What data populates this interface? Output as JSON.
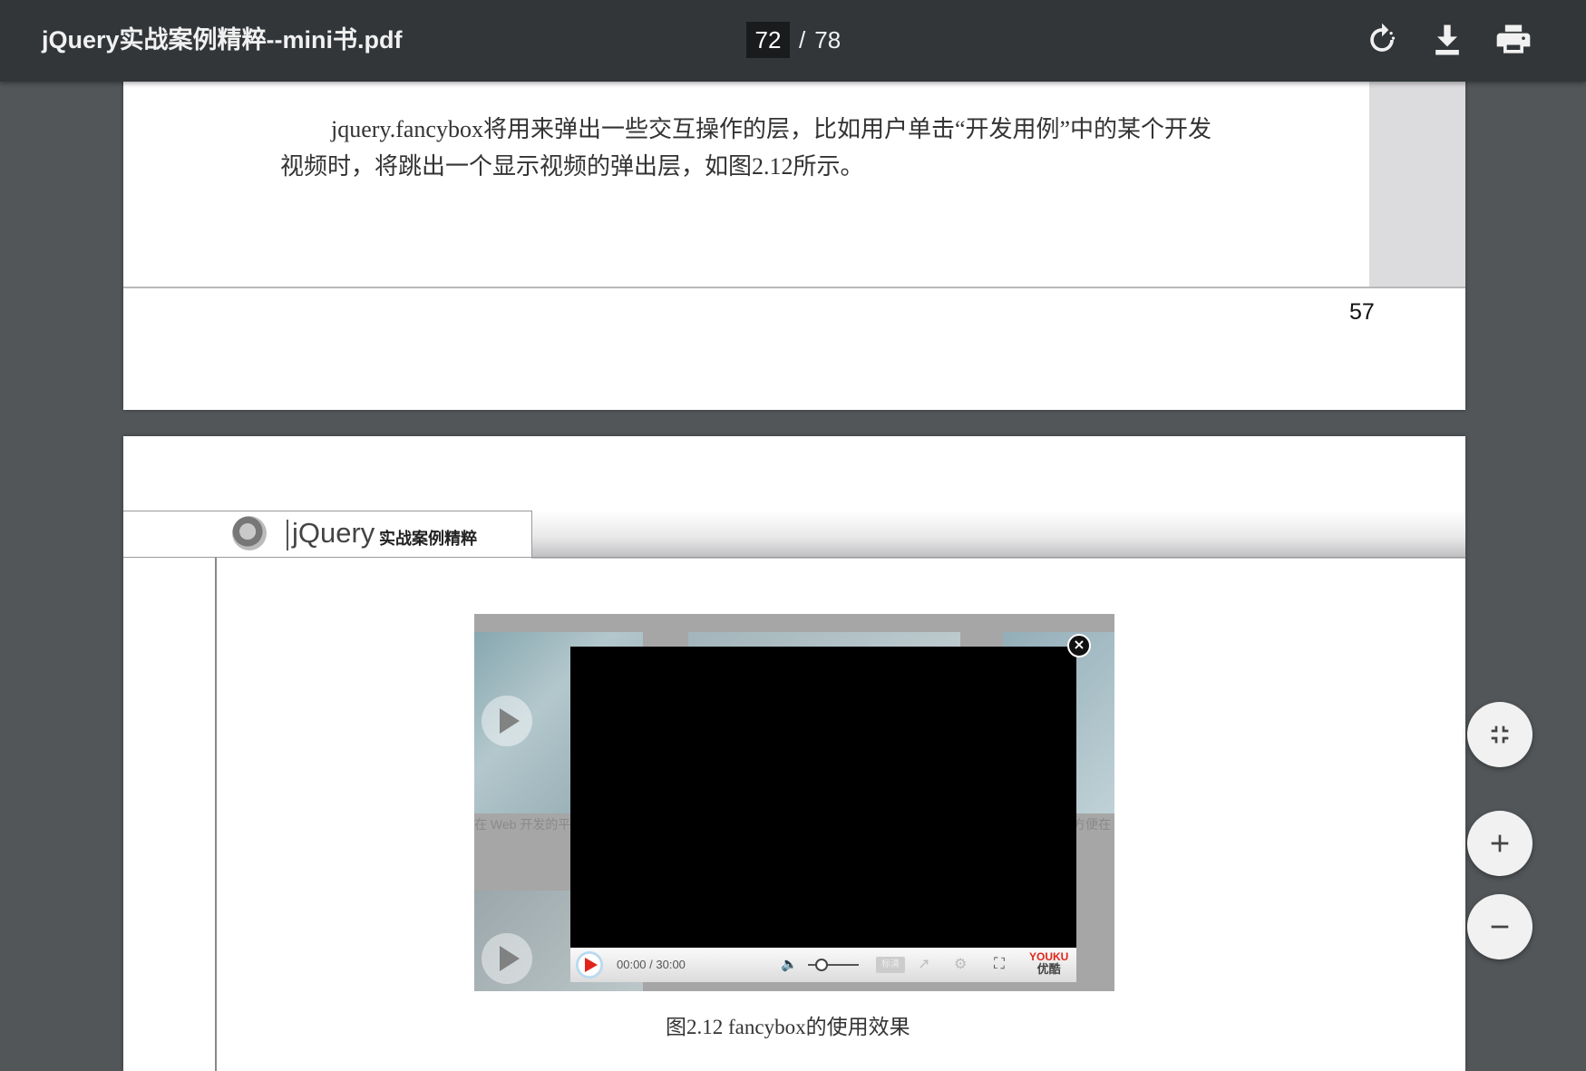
{
  "toolbar": {
    "title": "jQuery实战案例精粹--mini书.pdf",
    "current_page": "72",
    "separator": "/",
    "total_pages": "78",
    "buttons": [
      {
        "icon": "rotate-icon"
      },
      {
        "icon": "download-icon"
      },
      {
        "icon": "print-icon"
      }
    ]
  },
  "page1": {
    "paragraph_line1": "jquery.fancybox将用来弹出一些交互操作的层，比如用户单击“开发用例”中的某个开发",
    "paragraph_line2": "视频时，将跳出一个显示视频的弹出层，如图2.12所示。",
    "page_number": "57"
  },
  "page2": {
    "header_logo_text": "jQuery",
    "header_logo_cn": "实战案例精粹",
    "figure": {
      "faded_left": "在 Web 开发的平",
      "faded_right": "方便在",
      "player_time": "00:00 / 30:00",
      "quality_label": "标清",
      "brand_en": "YOUKU",
      "brand_cn": "优酷"
    },
    "caption": "图2.12  fancybox的使用效果"
  },
  "zoom_controls": [
    {
      "icon": "fit-page-icon"
    },
    {
      "icon": "zoom-in-icon"
    },
    {
      "icon": "zoom-out-icon"
    }
  ],
  "colors": {
    "toolbar_bg": "#323639",
    "viewer_bg": "#525659",
    "page_bg": "#ffffff",
    "fab_bg": "#f1f1f1",
    "youku_red": "#e0251b"
  }
}
